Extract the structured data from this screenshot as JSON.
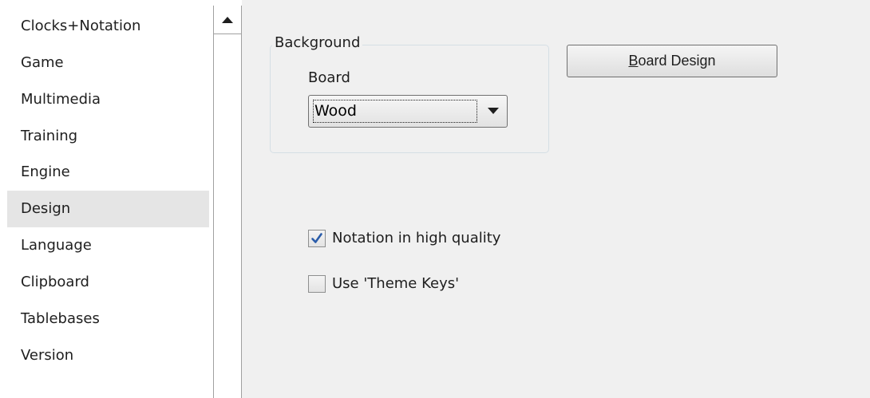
{
  "sidebar": {
    "items": [
      {
        "label": "Clocks+Notation"
      },
      {
        "label": "Game"
      },
      {
        "label": "Multimedia"
      },
      {
        "label": "Training"
      },
      {
        "label": "Engine"
      },
      {
        "label": "Design",
        "selected": true
      },
      {
        "label": "Language"
      },
      {
        "label": "Clipboard"
      },
      {
        "label": "Tablebases"
      },
      {
        "label": "Version"
      }
    ]
  },
  "scrollbar": {
    "up_icon": "triangle-up-icon"
  },
  "background_group": {
    "legend": "Background",
    "board_label": "Board",
    "board_select": {
      "value": "Wood",
      "icon": "dropdown-arrow-icon"
    }
  },
  "board_design_button": {
    "mnemonic": "B",
    "rest": "oard Design"
  },
  "options": {
    "notation_high_quality": {
      "label": "Notation in high quality",
      "checked": true
    },
    "use_theme_keys": {
      "label": "Use 'Theme Keys'",
      "checked": false
    }
  },
  "colors": {
    "panel_bg": "#f0f0f0",
    "selected_bg": "#e5e5e5",
    "check_blue": "#2a5caa"
  }
}
